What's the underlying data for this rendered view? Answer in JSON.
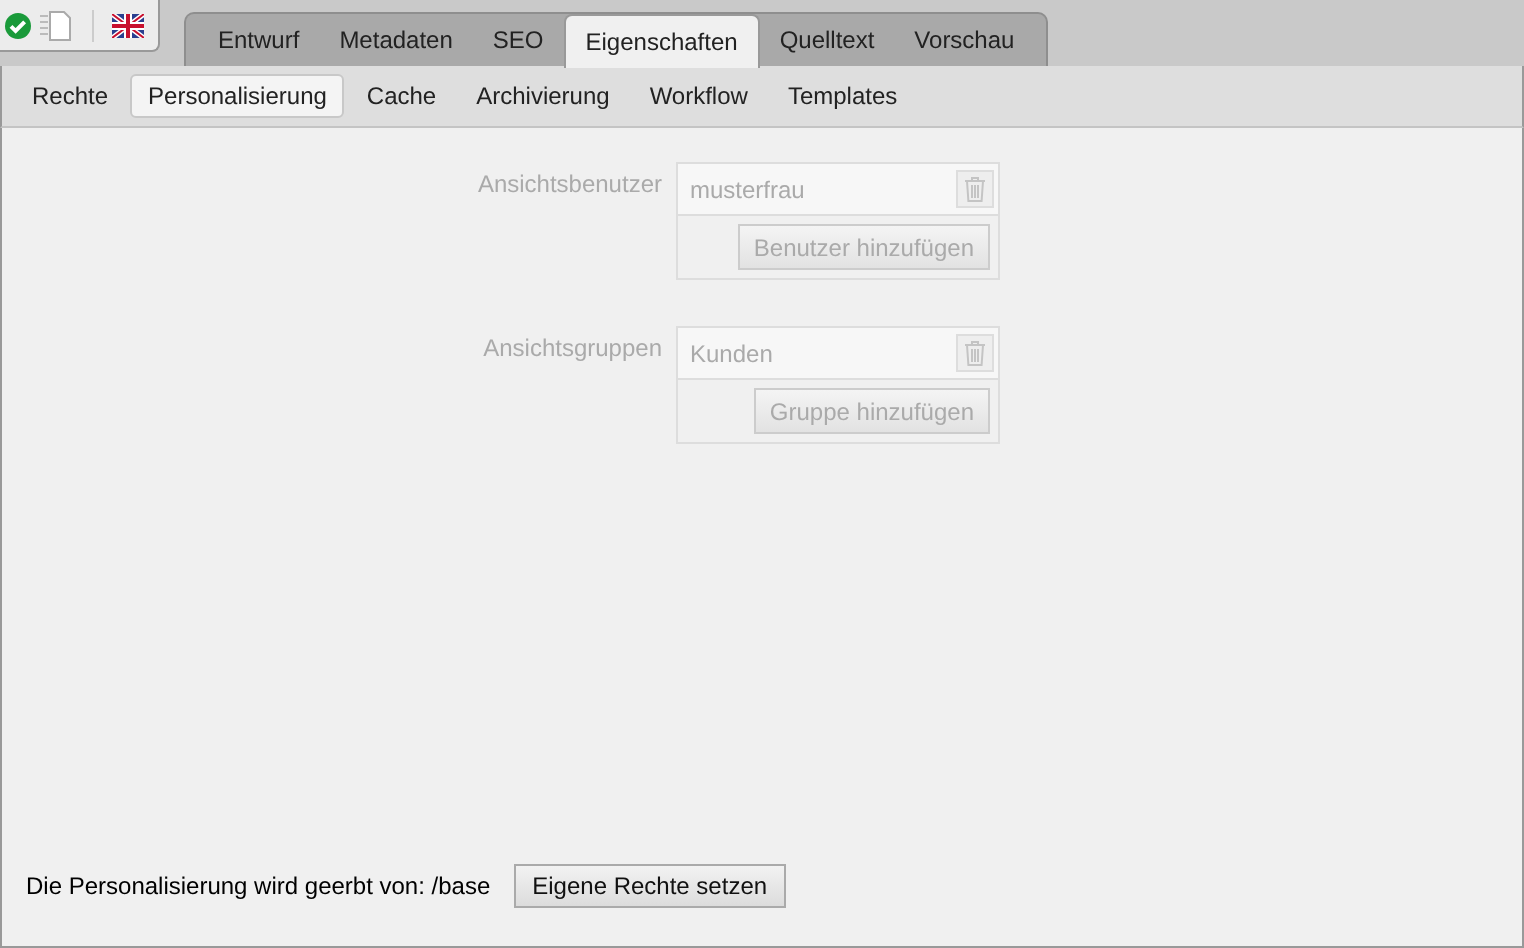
{
  "tabs": [
    {
      "label": "Entwurf",
      "selected": false
    },
    {
      "label": "Metadaten",
      "selected": false
    },
    {
      "label": "SEO",
      "selected": false
    },
    {
      "label": "Eigenschaften",
      "selected": true
    },
    {
      "label": "Quelltext",
      "selected": false
    },
    {
      "label": "Vorschau",
      "selected": false
    }
  ],
  "subtabs": [
    {
      "label": "Rechte",
      "selected": false
    },
    {
      "label": "Personalisierung",
      "selected": true
    },
    {
      "label": "Cache",
      "selected": false
    },
    {
      "label": "Archivierung",
      "selected": false
    },
    {
      "label": "Workflow",
      "selected": false
    },
    {
      "label": "Templates",
      "selected": false
    }
  ],
  "fields": [
    {
      "label": "Ansichtsbenutzer",
      "entries": [
        "musterfrau"
      ],
      "add_button": "Benutzer hinzufügen",
      "disabled": true
    },
    {
      "label": "Ansichtsgruppen",
      "entries": [
        "Kunden"
      ],
      "add_button": "Gruppe hinzufügen",
      "disabled": true
    }
  ],
  "footer": {
    "text": "Die Personalisierung wird geerbt von: /base",
    "button": "Eigene Rechte setzen"
  }
}
